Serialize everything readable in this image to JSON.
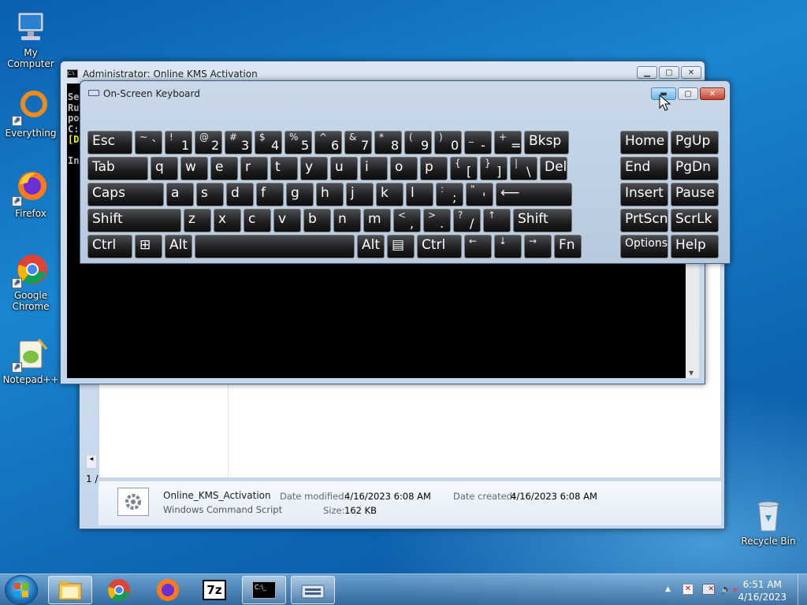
{
  "desktop": {
    "icons": [
      {
        "label": "My Computer",
        "icon": "computer-icon"
      },
      {
        "label": "Everything",
        "icon": "everything-icon"
      },
      {
        "label": "Firefox",
        "icon": "firefox-icon"
      },
      {
        "label": "Google Chrome",
        "icon": "chrome-icon"
      },
      {
        "label": "Notepad++",
        "icon": "notepadpp-icon"
      },
      {
        "label": "Recycle Bin",
        "icon": "recycle-bin-icon"
      }
    ]
  },
  "cmd_window": {
    "title": "Administrator:  Online KMS Activation",
    "lines": [
      "Se",
      "Ru",
      "po",
      "C:",
      "[D",
      "",
      "In"
    ]
  },
  "explorer_window": {
    "status_left": "1 /",
    "details": {
      "file_name": "Online_KMS_Activation",
      "file_type": "Windows Command Script",
      "date_modified_label": "Date modified:",
      "date_modified": "4/16/2023 6:08 AM",
      "size_label": "Size:",
      "size": "162 KB",
      "date_created_label": "Date created:",
      "date_created": "4/16/2023 6:08 AM"
    }
  },
  "osk_window": {
    "title": "On-Screen Keyboard",
    "rows": [
      [
        {
          "up": "",
          "lo": "",
          "main": "Esc"
        },
        {
          "up": "~",
          "lo": "`"
        },
        {
          "up": "!",
          "lo": "1"
        },
        {
          "up": "@",
          "lo": "2"
        },
        {
          "up": "#",
          "lo": "3"
        },
        {
          "up": "$",
          "lo": "4"
        },
        {
          "up": "%",
          "lo": "5"
        },
        {
          "up": "^",
          "lo": "6"
        },
        {
          "up": "&",
          "lo": "7"
        },
        {
          "up": "*",
          "lo": "8"
        },
        {
          "up": "(",
          "lo": "9"
        },
        {
          "up": ")",
          "lo": "0"
        },
        {
          "up": "_",
          "lo": "-"
        },
        {
          "up": "+",
          "lo": "="
        },
        {
          "main": "Bksp"
        },
        {
          "main": "Home"
        },
        {
          "main": "PgUp"
        }
      ],
      [
        {
          "main": "Tab"
        },
        {
          "main": "q"
        },
        {
          "main": "w"
        },
        {
          "main": "e"
        },
        {
          "main": "r"
        },
        {
          "main": "t"
        },
        {
          "main": "y"
        },
        {
          "main": "u"
        },
        {
          "main": "i"
        },
        {
          "main": "o"
        },
        {
          "main": "p"
        },
        {
          "up": "{",
          "lo": "["
        },
        {
          "up": "}",
          "lo": "]"
        },
        {
          "up": "|",
          "lo": "\\"
        },
        {
          "main": "Del"
        },
        {
          "main": "End"
        },
        {
          "main": "PgDn"
        }
      ],
      [
        {
          "main": "Caps"
        },
        {
          "main": "a"
        },
        {
          "main": "s"
        },
        {
          "main": "d"
        },
        {
          "main": "f"
        },
        {
          "main": "g"
        },
        {
          "main": "h"
        },
        {
          "main": "j"
        },
        {
          "main": "k"
        },
        {
          "main": "l"
        },
        {
          "up": ":",
          "lo": ";"
        },
        {
          "up": "\"",
          "lo": "'"
        },
        {
          "main": "⟵"
        },
        {
          "main": "Insert"
        },
        {
          "main": "Pause"
        }
      ],
      [
        {
          "main": "Shift"
        },
        {
          "main": "z"
        },
        {
          "main": "x"
        },
        {
          "main": "c"
        },
        {
          "main": "v"
        },
        {
          "main": "b"
        },
        {
          "main": "n"
        },
        {
          "main": "m"
        },
        {
          "up": "<",
          "lo": ","
        },
        {
          "up": ">",
          "lo": "."
        },
        {
          "up": "?",
          "lo": "/"
        },
        {
          "up": "↑",
          "lo": ""
        },
        {
          "main": "Shift"
        },
        {
          "main": "PrtScn"
        },
        {
          "main": "ScrLk"
        }
      ],
      [
        {
          "main": "Ctrl"
        },
        {
          "main": "⊞"
        },
        {
          "main": "Alt"
        },
        {
          "main": ""
        },
        {
          "main": "Alt"
        },
        {
          "main": "▤"
        },
        {
          "main": "Ctrl"
        },
        {
          "up": "←",
          "lo": ""
        },
        {
          "up": "↓",
          "lo": ""
        },
        {
          "up": "→",
          "lo": ""
        },
        {
          "main": "Fn"
        },
        {
          "main": "Options"
        },
        {
          "main": "Help"
        }
      ]
    ]
  },
  "taskbar": {
    "items": [
      "start-orb",
      "explorer",
      "chrome",
      "firefox",
      "7zip",
      "cmd",
      "osk"
    ],
    "clock_time": "6:51 AM",
    "clock_date": "4/16/2023"
  }
}
